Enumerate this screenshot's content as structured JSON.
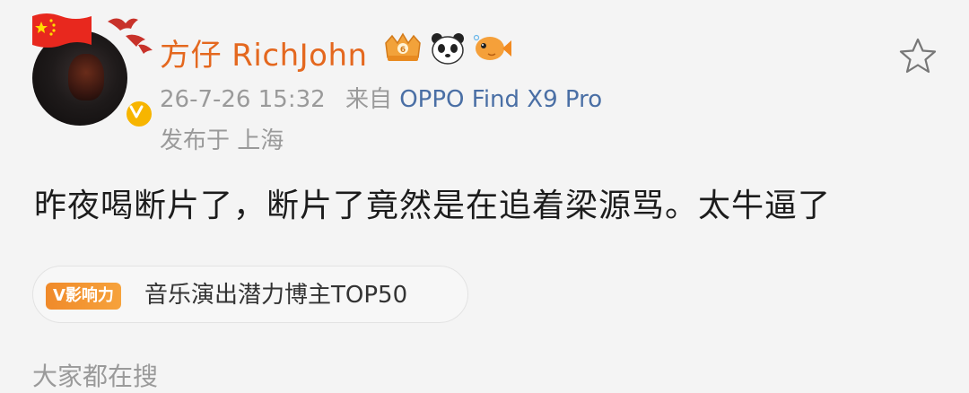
{
  "user": {
    "name": "方仔 RichJohn",
    "badge_icons": [
      "crown-fan-badge-icon",
      "panda-icon",
      "fish-icon"
    ]
  },
  "post": {
    "timestamp": "26-7-26 15:32",
    "source_prefix": "来自",
    "device": "OPPO Find X9 Pro",
    "location": "发布于 上海",
    "text": "昨夜喝断片了，断片了竟然是在追着梁源骂。太牛逼了"
  },
  "influence": {
    "badge_label": "V影响力",
    "rank_text": "音乐演出潜力博主TOP50"
  },
  "section": {
    "search_title": "大家都在搜"
  },
  "colors": {
    "username": "#e4681f",
    "device_link": "#4a6fa5",
    "verified": "#f7b500",
    "influence_badge": "#f08a2a"
  }
}
